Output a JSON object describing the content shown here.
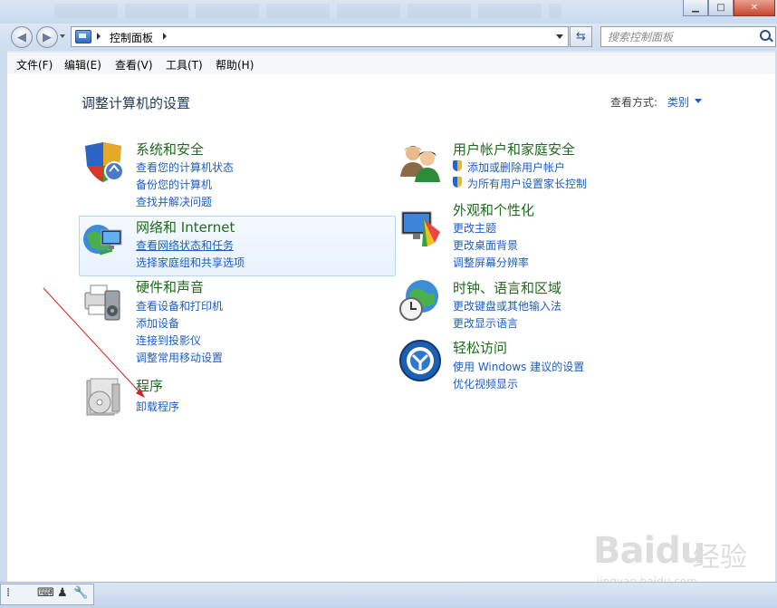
{
  "window": {
    "minimize_icon": "minimize-icon",
    "maximize_icon": "maximize-icon",
    "close_icon": "close-icon"
  },
  "address": {
    "breadcrumb": "控制面板"
  },
  "search": {
    "placeholder": "搜索控制面板"
  },
  "menu": [
    "文件(F)",
    "编辑(E)",
    "查看(V)",
    "工具(T)",
    "帮助(H)"
  ],
  "page": {
    "title": "调整计算机的设置",
    "view_by_label": "查看方式:",
    "view_by_value": "类别"
  },
  "categories": [
    {
      "heading": "系统和安全",
      "icon": "shield-icon",
      "links": [
        "查看您的计算机状态",
        "备份您的计算机",
        "查找并解决问题"
      ]
    },
    {
      "heading": "网络和 Internet",
      "icon": "network-icon",
      "links": [
        "查看网络状态和任务",
        "选择家庭组和共享选项"
      ]
    },
    {
      "heading": "硬件和声音",
      "icon": "printer-icon",
      "links": [
        "查看设备和打印机",
        "添加设备",
        "连接到投影仪",
        "调整常用移动设置"
      ]
    },
    {
      "heading": "程序",
      "icon": "programs-icon",
      "links": [
        "卸载程序"
      ]
    },
    {
      "heading": "用户帐户和家庭安全",
      "icon": "users-icon",
      "links": [
        "添加或删除用户帐户",
        "为所有用户设置家长控制"
      ]
    },
    {
      "heading": "外观和个性化",
      "icon": "monitor-icon",
      "links": [
        "更改主题",
        "更改桌面背景",
        "调整屏幕分辨率"
      ]
    },
    {
      "heading": "时钟、语言和区域",
      "icon": "globe-clock-icon",
      "links": [
        "更改键盘或其他输入法",
        "更改显示语言"
      ]
    },
    {
      "heading": "轻松访问",
      "icon": "ease-of-access-icon",
      "links": [
        "使用 Windows 建议的设置",
        "优化视频显示"
      ]
    }
  ],
  "watermark": {
    "brand": "Baidu",
    "suffix": "经验",
    "url": "jingyan.baidu.com"
  },
  "colors": {
    "heading": "#1e6b1e",
    "link": "#1e5dbf",
    "title": "#1e395b"
  }
}
